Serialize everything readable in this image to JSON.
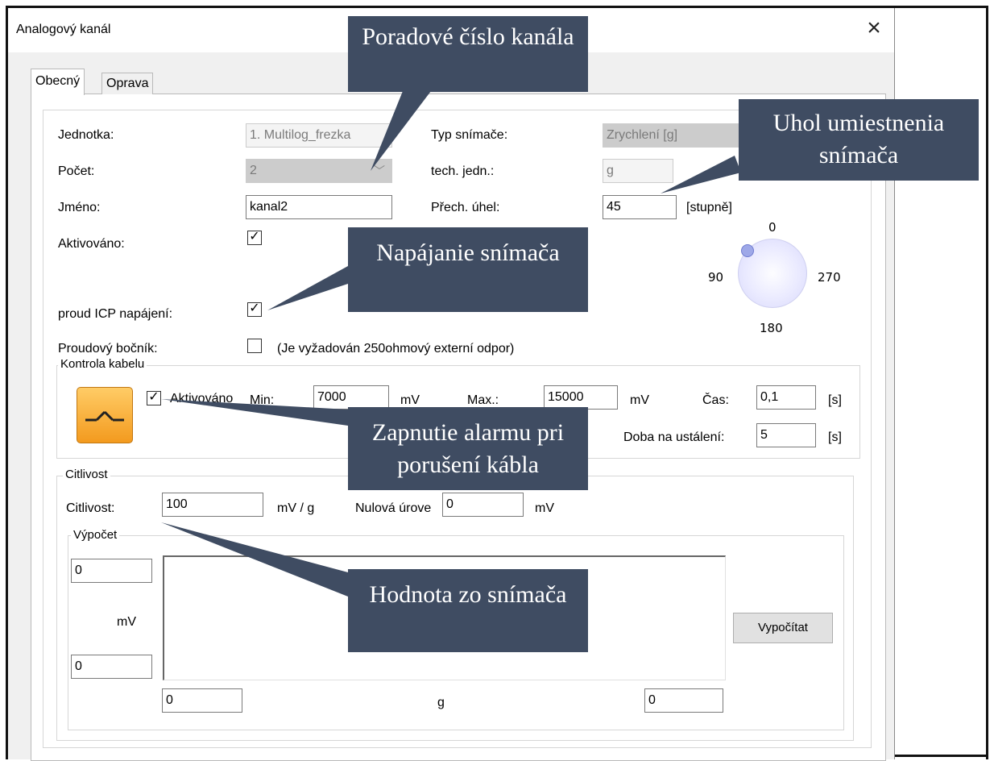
{
  "window": {
    "title": "Analogový kanál",
    "close_label": "×"
  },
  "tabs": [
    {
      "label": "Obecný"
    },
    {
      "label": "Oprava"
    }
  ],
  "fields": {
    "jednotka": {
      "label": "Jednotka:",
      "value": "1. Multilog_frezka"
    },
    "pocet": {
      "label": "Počet:",
      "value": "2"
    },
    "jmeno": {
      "label": "Jméno:",
      "value": "kanal2"
    },
    "aktivovano": {
      "label": "Aktivováno:",
      "checked": true
    },
    "proud_icp": {
      "label": "proud ICP napájení:",
      "checked": true
    },
    "proudovy_bocnik": {
      "label": "Proudový bočník:",
      "checked": false,
      "note": "(Je vyžadován 250ohmový externí odpor)"
    },
    "typ_snimace": {
      "label": "Typ snímače:",
      "value": "Zrychlení [g]"
    },
    "tech_jedn": {
      "label": "tech. jedn.:",
      "value": "g"
    },
    "prech_uhel": {
      "label": "Přech. úhel:",
      "value": "45",
      "unit": "[stupně]"
    }
  },
  "gauge": {
    "top": "0",
    "left": "90",
    "right": "270",
    "bottom": "180",
    "angle_deg": 45
  },
  "kontrola_kabelu": {
    "legend": "Kontrola kabelu",
    "aktivovano_label": "Aktivováno",
    "checked": true,
    "min_label": "Min:",
    "min_value": "7000",
    "min_unit": "mV",
    "max_label": "Max.:",
    "max_value": "15000",
    "max_unit": "mV",
    "cas_label": "Čas:",
    "cas_value": "0,1",
    "cas_unit": "[s]",
    "doba_label": "Doba na ustálení:",
    "doba_value": "5",
    "doba_unit": "[s]"
  },
  "citlivost": {
    "legend": "Citlivost",
    "label": "Citlivost:",
    "value": "100",
    "unit": "mV / g",
    "nulova_label": "Nulová úrove",
    "nulova_value": "0",
    "nulova_unit": "mV"
  },
  "vypocet": {
    "legend": "Výpočet",
    "top_value": "0",
    "mv_label": "mV",
    "bottom_value": "0",
    "x_left_value": "0",
    "x_unit": "g",
    "x_right_value": "0",
    "button_label": "Vypočítat"
  },
  "callouts": {
    "poradove": "Poradové číslo kanála",
    "uhol": "Uhol umiestnenia snímača",
    "napajanie": "Napájanie snímača",
    "zapnutie": "Zapnutie alarmu pri porušení kábla",
    "hodnota": "Hodnota zo snímača"
  },
  "colors": {
    "callout_bg": "#3f4c62",
    "callout_text": "#ffffff",
    "alarm_icon": "#f5a623"
  }
}
